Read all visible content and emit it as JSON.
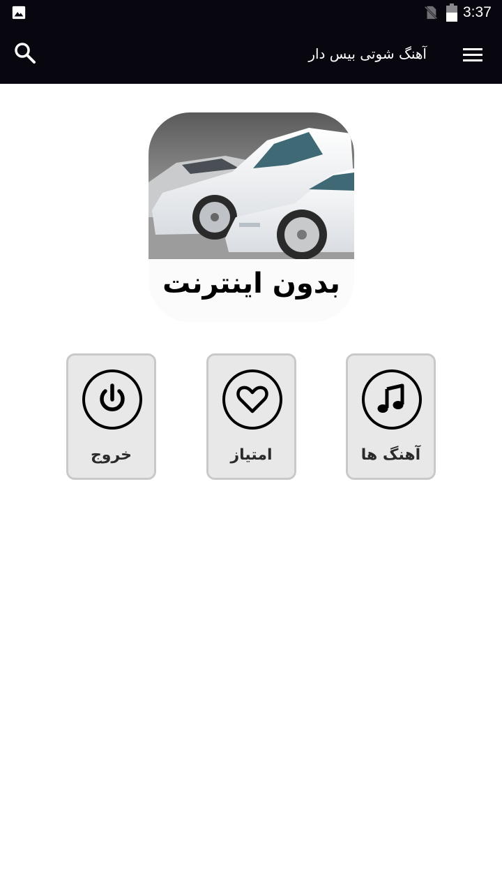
{
  "status_bar": {
    "time": "3:37",
    "icons": [
      "gallery-icon",
      "no-sim-icon",
      "battery-icon"
    ]
  },
  "toolbar": {
    "title": "آهنگ شوتی بیس دار",
    "icons": [
      "search-icon",
      "hamburger-menu-icon"
    ],
    "background": "#08060f"
  },
  "logo": {
    "caption": "بدون اینترنت"
  },
  "menu": {
    "items": [
      {
        "label": "آهنگ ها",
        "icon": "music-note-icon"
      },
      {
        "label": "امتیاز",
        "icon": "heart-icon"
      },
      {
        "label": "خروج",
        "icon": "power-icon"
      }
    ]
  },
  "colors": {
    "tile_background": "#e8e8e8",
    "tile_border": "#c9c9c9"
  }
}
